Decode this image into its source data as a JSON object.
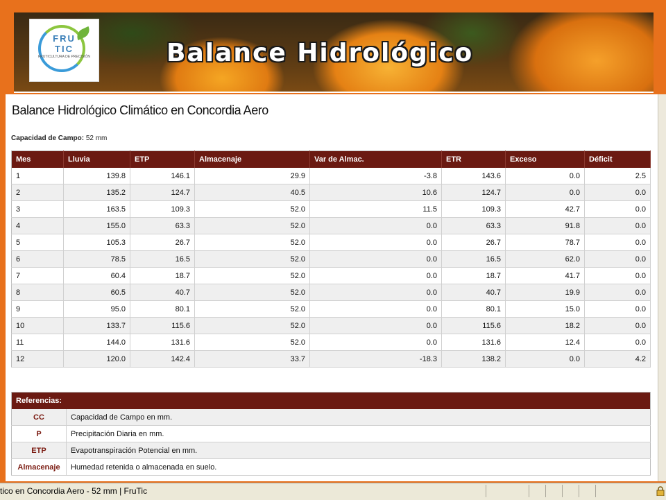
{
  "banner": {
    "title": "Balance Hidrológico",
    "logo": {
      "line1": "FRU",
      "line2": "TIC",
      "tagline": "FRUTICULTURA DE PRECISIÓN"
    }
  },
  "page": {
    "title": "Balance Hidrológico Climático en Concordia Aero",
    "capacity_label": "Capacidad de Campo:",
    "capacity_value": "52 mm"
  },
  "table": {
    "headers": [
      "Mes",
      "Lluvia",
      "ETP",
      "Almacenaje",
      "Var de Almac.",
      "ETR",
      "Exceso",
      "Déficit"
    ],
    "rows": [
      [
        "1",
        "139.8",
        "146.1",
        "29.9",
        "-3.8",
        "143.6",
        "0.0",
        "2.5"
      ],
      [
        "2",
        "135.2",
        "124.7",
        "40.5",
        "10.6",
        "124.7",
        "0.0",
        "0.0"
      ],
      [
        "3",
        "163.5",
        "109.3",
        "52.0",
        "11.5",
        "109.3",
        "42.7",
        "0.0"
      ],
      [
        "4",
        "155.0",
        "63.3",
        "52.0",
        "0.0",
        "63.3",
        "91.8",
        "0.0"
      ],
      [
        "5",
        "105.3",
        "26.7",
        "52.0",
        "0.0",
        "26.7",
        "78.7",
        "0.0"
      ],
      [
        "6",
        "78.5",
        "16.5",
        "52.0",
        "0.0",
        "16.5",
        "62.0",
        "0.0"
      ],
      [
        "7",
        "60.4",
        "18.7",
        "52.0",
        "0.0",
        "18.7",
        "41.7",
        "0.0"
      ],
      [
        "8",
        "60.5",
        "40.7",
        "52.0",
        "0.0",
        "40.7",
        "19.9",
        "0.0"
      ],
      [
        "9",
        "95.0",
        "80.1",
        "52.0",
        "0.0",
        "80.1",
        "15.0",
        "0.0"
      ],
      [
        "10",
        "133.7",
        "115.6",
        "52.0",
        "0.0",
        "115.6",
        "18.2",
        "0.0"
      ],
      [
        "11",
        "144.0",
        "131.6",
        "52.0",
        "0.0",
        "131.6",
        "12.4",
        "0.0"
      ],
      [
        "12",
        "120.0",
        "142.4",
        "33.7",
        "-18.3",
        "138.2",
        "0.0",
        "4.2"
      ]
    ]
  },
  "references": {
    "header": "Referencias:",
    "items": [
      {
        "abbr": "CC",
        "desc": "Capacidad de Campo en mm."
      },
      {
        "abbr": "P",
        "desc": "Precipitación Diaria en mm."
      },
      {
        "abbr": "ETP",
        "desc": "Evapotranspiración Potencial en mm."
      },
      {
        "abbr": "Almacenaje",
        "desc": "Humedad retenida o almacenada en suelo."
      }
    ]
  },
  "statusbar": {
    "text": "tico en Concordia Aero - 52 mm | FruTic",
    "icon": "lock-icon"
  }
}
